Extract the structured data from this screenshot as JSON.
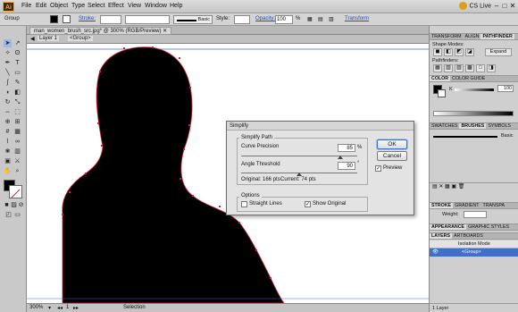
{
  "menubar": {
    "app_icon": "Ai",
    "items": [
      "File",
      "Edit",
      "Object",
      "Type",
      "Select",
      "Effect",
      "View",
      "Window",
      "Help"
    ],
    "cs_live": "CS Live",
    "min": "–",
    "max": "□",
    "close": "✕"
  },
  "control": {
    "selection": "Group",
    "stroke_label": "Stroke:",
    "brush": "Basic",
    "style_label": "Style:",
    "opacity_label": "Opacity:",
    "opacity_value": "100",
    "opacity_unit": "%",
    "transform_label": "Transform"
  },
  "document": {
    "tab_title": "man_women_brush_src.jpg* @ 300% (RGB/Preview)",
    "layer": "Layer 1",
    "group": "<Group>"
  },
  "status": {
    "zoom": "300%",
    "page": "1",
    "tool": "Selection"
  },
  "dialog": {
    "title": "Simplify",
    "simplify_path_label": "Simplify Path",
    "curve_precision_label": "Curve Precision",
    "curve_precision_value": "85",
    "curve_precision_unit": "%",
    "curve_precision_fraction": 0.85,
    "angle_threshold_label": "Angle Threshold",
    "angle_threshold_value": "90",
    "angle_threshold_unit": "°",
    "angle_threshold_fraction": 0.5,
    "original_text": "Original: 166 pts",
    "current_text": "Current: 74 pts",
    "options_label": "Options",
    "straight_lines_label": "Straight Lines",
    "straight_lines_checked": false,
    "show_original_label": "Show Original",
    "show_original_checked": true,
    "ok_label": "OK",
    "cancel_label": "Cancel",
    "preview_label": "Preview",
    "preview_checked": true
  },
  "panels": {
    "pathfinder_tabs": [
      "TRANSFORM",
      "ALIGN",
      "PATHFINDER"
    ],
    "shape_modes": "Shape Modes:",
    "expand": "Expand",
    "pathfinders": "Pathfinders:",
    "color_tabs": [
      "COLOR",
      "COLOR GUIDE"
    ],
    "k_label": "K",
    "k_value": "100",
    "swatch_tabs": [
      "SWATCHES",
      "BRUSHES",
      "SYMBOLS"
    ],
    "brush_basic": "Basic",
    "stroke_tabs": [
      "STROKE",
      "GRADIENT",
      "TRANSPA"
    ],
    "weight_label": "Weight:",
    "appearance_tabs": [
      "APPEARANCE",
      "GRAPHIC STYLES"
    ],
    "layers_tabs": [
      "LAYERS",
      "ARTBOARDS"
    ],
    "isolation_mode": "Isolation Mode",
    "layer_group": "<Group>",
    "layers_count": "1 Layer"
  },
  "colors": {
    "silhouette": "#000000",
    "path_outline": "#d02040",
    "selection_blue": "#3f6fc7",
    "cs_live_dot": "#d8a020"
  }
}
